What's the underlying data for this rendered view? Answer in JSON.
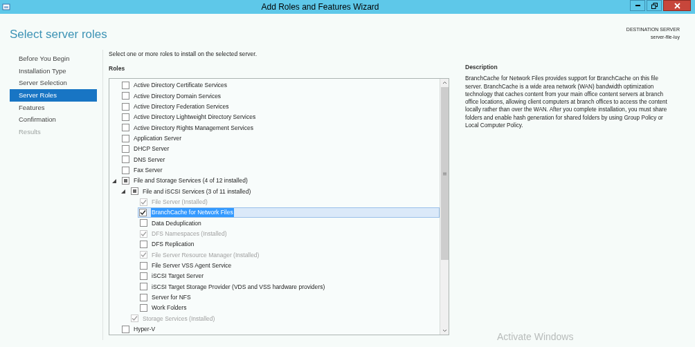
{
  "window": {
    "title": "Add Roles and Features Wizard"
  },
  "page_title": "Select server roles",
  "destination": {
    "label": "DESTINATION SERVER",
    "server": "server-file-luy"
  },
  "steps": [
    {
      "label": "Before You Begin",
      "selected": false,
      "disabled": false
    },
    {
      "label": "Installation Type",
      "selected": false,
      "disabled": false
    },
    {
      "label": "Server Selection",
      "selected": false,
      "disabled": false
    },
    {
      "label": "Server Roles",
      "selected": true,
      "disabled": false
    },
    {
      "label": "Features",
      "selected": false,
      "disabled": false
    },
    {
      "label": "Confirmation",
      "selected": false,
      "disabled": false
    },
    {
      "label": "Results",
      "selected": false,
      "disabled": true
    }
  ],
  "instruction": "Select one or more roles to install on the selected server.",
  "roles_heading": "Roles",
  "roles": [
    {
      "label": "Active Directory Certificate Services",
      "checked": false,
      "disabled": false,
      "selected": false
    },
    {
      "label": "Active Directory Domain Services",
      "checked": false,
      "disabled": false,
      "selected": false
    },
    {
      "label": "Active Directory Federation Services",
      "checked": false,
      "disabled": false,
      "selected": false
    },
    {
      "label": "Active Directory Lightweight Directory Services",
      "checked": false,
      "disabled": false,
      "selected": false
    },
    {
      "label": "Active Directory Rights Management Services",
      "checked": false,
      "disabled": false,
      "selected": false
    },
    {
      "label": "Application Server",
      "checked": false,
      "disabled": false,
      "selected": false
    },
    {
      "label": "DHCP Server",
      "checked": false,
      "disabled": false,
      "selected": false
    },
    {
      "label": "DNS Server",
      "checked": false,
      "disabled": false,
      "selected": false
    },
    {
      "label": "Fax Server",
      "checked": false,
      "disabled": false,
      "selected": false
    },
    {
      "label": "File and Storage Services (4 of 12 installed)",
      "partial": true,
      "disabled": false,
      "selected": false,
      "expanded": true,
      "children": [
        {
          "label": "File and iSCSI Services (3 of 11 installed)",
          "partial": true,
          "disabled": false,
          "selected": false,
          "expanded": true,
          "children": [
            {
              "label": "File Server (Installed)",
              "checked": true,
              "disabled": true,
              "selected": false
            },
            {
              "label": "BranchCache for Network Files",
              "checked": true,
              "disabled": false,
              "selected": true
            },
            {
              "label": "Data Deduplication",
              "checked": false,
              "disabled": false,
              "selected": false
            },
            {
              "label": "DFS Namespaces (Installed)",
              "checked": true,
              "disabled": true,
              "selected": false
            },
            {
              "label": "DFS Replication",
              "checked": false,
              "disabled": false,
              "selected": false
            },
            {
              "label": "File Server Resource Manager (Installed)",
              "checked": true,
              "disabled": true,
              "selected": false
            },
            {
              "label": "File Server VSS Agent Service",
              "checked": false,
              "disabled": false,
              "selected": false
            },
            {
              "label": "iSCSI Target Server",
              "checked": false,
              "disabled": false,
              "selected": false
            },
            {
              "label": "iSCSI Target Storage Provider (VDS and VSS hardware providers)",
              "checked": false,
              "disabled": false,
              "selected": false
            },
            {
              "label": "Server for NFS",
              "checked": false,
              "disabled": false,
              "selected": false
            },
            {
              "label": "Work Folders",
              "checked": false,
              "disabled": false,
              "selected": false
            }
          ]
        },
        {
          "label": "Storage Services (Installed)",
          "checked": true,
          "disabled": true,
          "selected": false
        }
      ]
    },
    {
      "label": "Hyper-V",
      "checked": false,
      "disabled": false,
      "selected": false
    }
  ],
  "description": {
    "heading": "Description",
    "text": "BranchCache for Network Files provides support for BranchCache on this file server. BranchCache is a wide area network (WAN) bandwidth optimization technology that caches content from your main office content servers at branch office locations, allowing client computers at branch offices to access the content locally rather than over the WAN. After you complete installation, you must share folders and enable hash generation for shared folders by using Group Policy or Local Computer Policy."
  },
  "activation_notice": "Activate Windows"
}
